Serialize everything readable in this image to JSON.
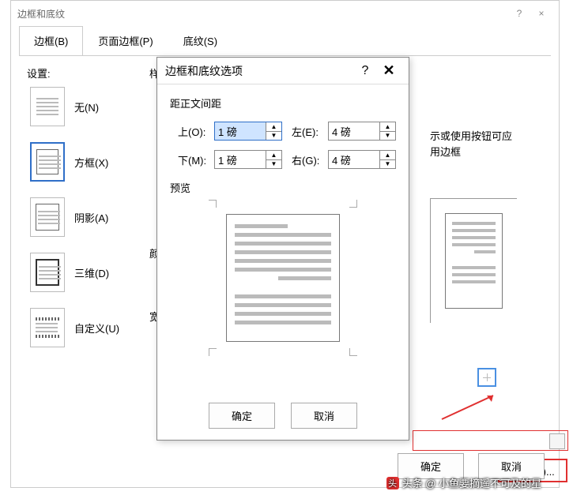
{
  "main": {
    "title": "边框和底纹",
    "help": "?",
    "close": "×",
    "tabs": {
      "border": "边框(B)",
      "page": "页面边框(P)",
      "shading": "底纹(S)"
    },
    "settings_label": "设置:",
    "style_cut": "样",
    "color_cut": "颜",
    "width_cut": "宽",
    "settings": {
      "none": "无(N)",
      "box": "方框(X)",
      "shadow": "阴影(A)",
      "threed": "三维(D)",
      "custom": "自定义(U)"
    },
    "right_hint1": "示或使用按钮可应",
    "right_hint2": "用边框",
    "options_btn": "选项(O)...",
    "ok": "确定",
    "cancel": "取消"
  },
  "sub": {
    "title": "边框和底纹选项",
    "help": "?",
    "close": "✕",
    "group": "距正文间距",
    "top_label": "上(O):",
    "top_value": "1 磅",
    "bottom_label": "下(M):",
    "bottom_value": "1 磅",
    "left_label": "左(E):",
    "left_value": "4 磅",
    "right_label": "右(G):",
    "right_value": "4 磅",
    "preview": "预览",
    "ok": "确定",
    "cancel": "取消"
  },
  "watermark": "头条 @ 小鱼要摘遥不可及的星"
}
